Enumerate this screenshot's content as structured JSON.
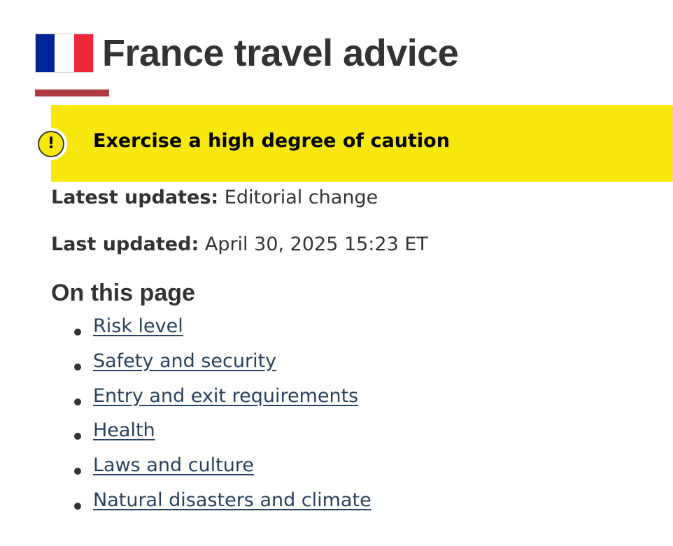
{
  "page": {
    "title": "France travel advice",
    "flag": {
      "icon": "france-flag-icon",
      "colors": [
        "#002395",
        "#ffffff",
        "#ed2939"
      ]
    },
    "accent_color": "#af3c43"
  },
  "advisory": {
    "icon": "exclamation-icon",
    "icon_glyph": "!",
    "text": "Exercise a high degree of caution",
    "color": "#f8e70d"
  },
  "meta": {
    "latest_updates_label": "Latest updates:",
    "latest_updates_value": "Editorial change",
    "last_updated_label": "Last updated:",
    "last_updated_value": "April 30, 2025 15:23 ET"
  },
  "toc": {
    "heading": "On this page",
    "link_color": "#284162",
    "items": [
      {
        "label": "Risk level"
      },
      {
        "label": "Safety and security"
      },
      {
        "label": "Entry and exit requirements"
      },
      {
        "label": "Health"
      },
      {
        "label": "Laws and culture"
      },
      {
        "label": "Natural disasters and climate"
      }
    ]
  }
}
